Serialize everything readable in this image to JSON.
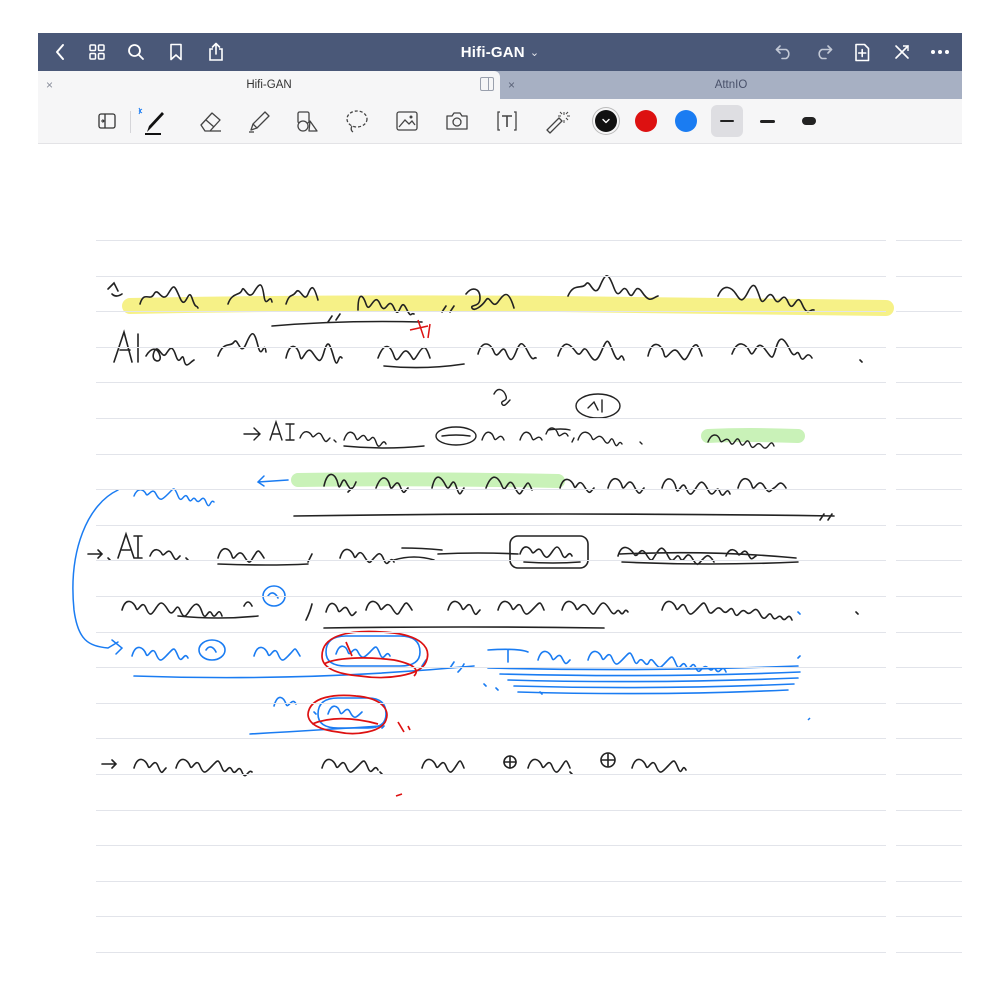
{
  "navbar": {
    "title": "Hifi-GAN",
    "title_chevron": "⌄"
  },
  "tabs": [
    {
      "label": "Hifi-GAN",
      "active": true,
      "close": "×"
    },
    {
      "label": "AttnIO",
      "active": false,
      "close": "×"
    }
  ],
  "toolbar": {
    "colors": [
      "#111111",
      "#dd1111",
      "#1a7cf2"
    ],
    "selected_color": "#111111",
    "accent_navbar": "#4a5878"
  }
}
